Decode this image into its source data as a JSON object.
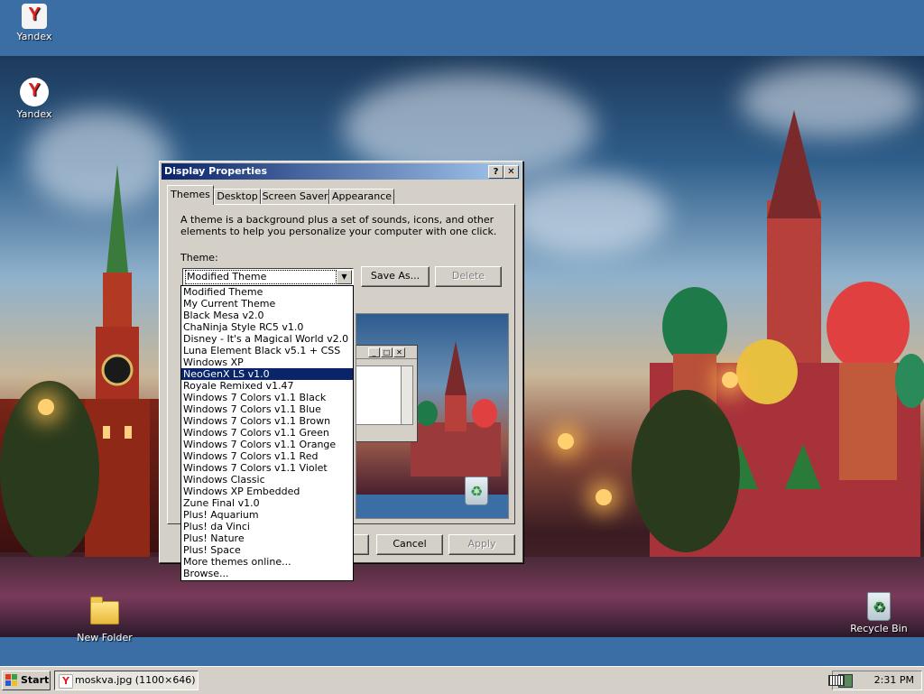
{
  "desktop": {
    "icons": [
      {
        "name": "yandex-icon-top",
        "label": "Yandex"
      },
      {
        "name": "yandex-icon",
        "label": "Yandex"
      },
      {
        "name": "new-folder",
        "label": "New Folder"
      },
      {
        "name": "recycle-bin",
        "label": "Recycle Bin"
      }
    ]
  },
  "dialog": {
    "title": "Display Properties",
    "help_glyph": "?",
    "close_glyph": "✕",
    "tabs": [
      "Themes",
      "Desktop",
      "Screen Saver",
      "Appearance"
    ],
    "description": "A theme is a background plus a set of sounds, icons, and other elements to help you personalize your computer with one click.",
    "theme_label": "Theme:",
    "theme_value": "Modified Theme",
    "save_as_label": "Save As...",
    "delete_label": "Delete",
    "cancel_label": "Cancel",
    "apply_label": "Apply",
    "theme_options": [
      "Modified Theme",
      "My Current Theme",
      "Black Mesa v2.0",
      "ChaNinja Style RC5 v1.0",
      "Disney - It's a Magical World v2.0",
      "Luna Element Black v5.1 + CSS",
      "Windows XP",
      "NeoGenX LS v1.0",
      "Royale Remixed v1.47",
      "Windows 7 Colors v1.1 Black",
      "Windows 7 Colors v1.1 Blue",
      "Windows 7 Colors v1.1 Brown",
      "Windows 7 Colors v1.1 Green",
      "Windows 7 Colors v1.1 Orange",
      "Windows 7 Colors v1.1 Red",
      "Windows 7 Colors v1.1 Violet",
      "Windows Classic",
      "Windows XP Embedded",
      "Zune Final v1.0",
      "Plus! Aquarium",
      "Plus! da Vinci",
      "Plus! Nature",
      "Plus! Space",
      "More themes online...",
      "Browse..."
    ],
    "highlighted_option": "NeoGenX LS v1.0"
  },
  "taskbar": {
    "start_label": "Start",
    "task_label": "moskva.jpg (1100×646) ...",
    "clock": "2:31 PM"
  },
  "colors": {
    "desktop": "#3a6ea5",
    "title_start": "#0a246a",
    "title_end": "#a6caf0",
    "face": "#d4d0c8",
    "selection": "#0a246a"
  }
}
